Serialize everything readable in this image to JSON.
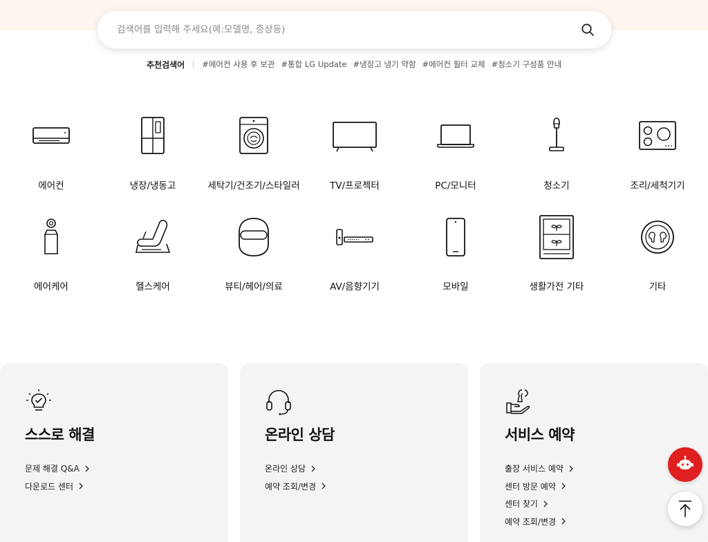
{
  "search": {
    "placeholder": "검색어를 입력해 주세요(예:모델명, 증상등)",
    "icon": "search-icon"
  },
  "recommended": {
    "label": "추천검색어",
    "tags": [
      "#에어컨 사용 후 보관",
      "#통합 LG Update",
      "#냉장고 냉기 약함",
      "#에어컨 필터 교체",
      "#청소기 구성품 안내"
    ]
  },
  "categories": {
    "row1": [
      {
        "label": "에어컨",
        "icon": "air-conditioner-icon"
      },
      {
        "label": "냉장/냉동고",
        "icon": "refrigerator-icon"
      },
      {
        "label": "세탁기/건조기/스타일러",
        "icon": "washing-machine-icon"
      },
      {
        "label": "TV/프로젝터",
        "icon": "tv-icon"
      },
      {
        "label": "PC/모니터",
        "icon": "laptop-icon"
      },
      {
        "label": "청소기",
        "icon": "vacuum-icon"
      },
      {
        "label": "조리/세척기기",
        "icon": "cooktop-icon"
      }
    ],
    "row2": [
      {
        "label": "에어케어",
        "icon": "air-purifier-icon"
      },
      {
        "label": "헬스케어",
        "icon": "massage-chair-icon"
      },
      {
        "label": "뷰티/헤어/의료",
        "icon": "beauty-mask-icon"
      },
      {
        "label": "AV/음향기기",
        "icon": "soundbar-icon"
      },
      {
        "label": "모바일",
        "icon": "mobile-icon"
      },
      {
        "label": "생활가전 기타",
        "icon": "plant-cabinet-icon"
      },
      {
        "label": "기타",
        "icon": "earbuds-icon"
      }
    ]
  },
  "cards": [
    {
      "title": "스스로 해결",
      "icon": "lightbulb-check-icon",
      "links": [
        "문제 해결 Q&A",
        "다운로드 센터"
      ]
    },
    {
      "title": "온라인 상담",
      "icon": "headset-icon",
      "links": [
        "온라인 상담",
        "예약 조회/변경"
      ]
    },
    {
      "title": "서비스 예약",
      "icon": "wrench-hand-icon",
      "links": [
        "출장 서비스 예약",
        "센터 방문 예약",
        "센터 찾기",
        "예약 조회/변경"
      ]
    }
  ],
  "floating": {
    "chatbot_icon": "robot-icon",
    "top_icon": "arrow-up-icon",
    "accent": "#e02020"
  }
}
